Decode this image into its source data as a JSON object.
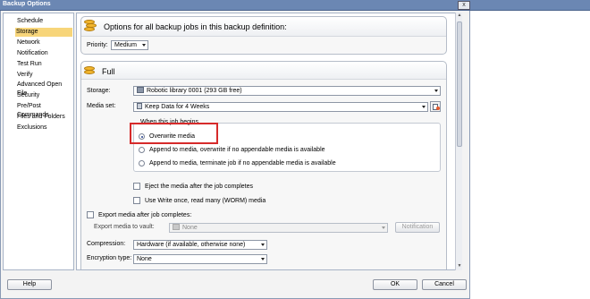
{
  "window": {
    "title": "Backup Options",
    "close_glyph": "x"
  },
  "nav": {
    "items": [
      {
        "label": "Schedule",
        "selected": false
      },
      {
        "label": "Storage",
        "selected": true
      },
      {
        "label": "Network",
        "selected": false
      },
      {
        "label": "Notification",
        "selected": false
      },
      {
        "label": "Test Run",
        "selected": false
      },
      {
        "label": "Verify",
        "selected": false
      },
      {
        "label": "Advanced Open File",
        "selected": false
      },
      {
        "label": "Security",
        "selected": false
      },
      {
        "label": "Pre/Post Commands",
        "selected": false
      },
      {
        "label": "Files and Folders",
        "selected": false
      },
      {
        "label": "Exclusions",
        "selected": false
      }
    ]
  },
  "all_jobs": {
    "header": "Options for all backup jobs in this backup definition:",
    "priority_label": "Priority:",
    "priority_value": "Medium"
  },
  "full": {
    "header": "Full",
    "storage_label": "Storage:",
    "storage_value": "Robotic library 0001 (293 GB free)",
    "media_set_label": "Media set:",
    "media_set_value": "Keep Data for 4 Weeks",
    "when_begins_title": "When this job begins",
    "radios": [
      {
        "label": "Overwrite media",
        "checked": true
      },
      {
        "label": "Append to media, overwrite if no appendable media is available",
        "checked": false
      },
      {
        "label": "Append to media, terminate job if no appendable media is available",
        "checked": false
      }
    ],
    "eject_label": "Eject the media after the job completes",
    "worm_label": "Use Write once, read many (WORM) media",
    "export_label": "Export media after job completes:",
    "export_vault_label": "Export media to vault:",
    "export_vault_value": "None",
    "notification_button": "Notification",
    "compression_label": "Compression:",
    "compression_value": "Hardware (if available, otherwise none)",
    "encryption_label": "Encryption type:",
    "encryption_value": "None"
  },
  "footer": {
    "help": "Help",
    "ok": "OK",
    "cancel": "Cancel"
  },
  "colors": {
    "selection": "#f7d57a",
    "highlight_box": "#d62a2a",
    "titlebar": "#6b87b3"
  },
  "icons": {
    "backup": "coins-icon",
    "storage_device": "robotic-library-icon",
    "media_properties": "media-set-properties-icon"
  }
}
